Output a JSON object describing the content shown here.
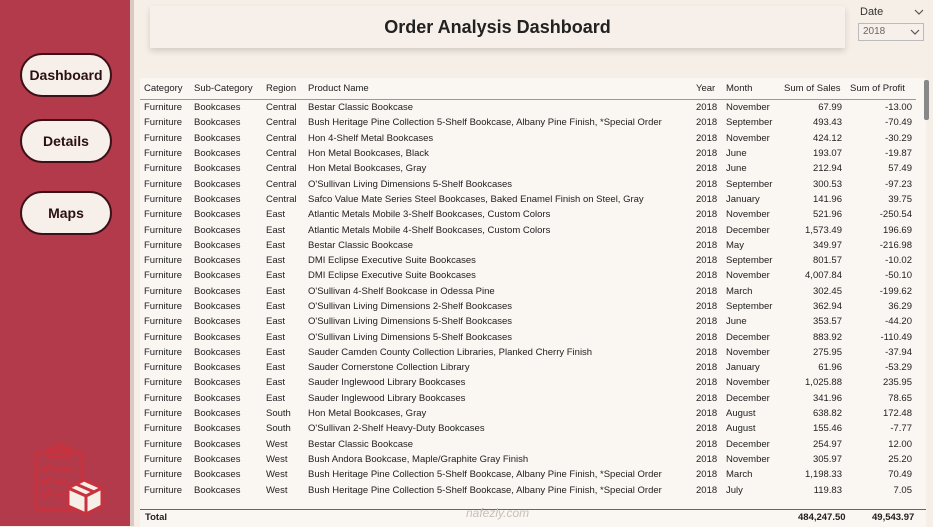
{
  "nav": {
    "dashboard": "Dashboard",
    "details": "Details",
    "maps": "Maps"
  },
  "title": "Order Analysis Dashboard",
  "date_filter": {
    "label": "Date",
    "selected": "2018"
  },
  "table": {
    "headers": [
      "Category",
      "Sub-Category",
      "Region",
      "Product Name",
      "Year",
      "Month",
      "Sum of Sales",
      "Sum of Profit"
    ],
    "rows": [
      [
        "Furniture",
        "Bookcases",
        "Central",
        "Bestar Classic Bookcase",
        "2018",
        "November",
        "67.99",
        "-13.00"
      ],
      [
        "Furniture",
        "Bookcases",
        "Central",
        "Bush Heritage Pine Collection 5-Shelf Bookcase, Albany Pine Finish, *Special Order",
        "2018",
        "September",
        "493.43",
        "-70.49"
      ],
      [
        "Furniture",
        "Bookcases",
        "Central",
        "Hon 4-Shelf Metal Bookcases",
        "2018",
        "November",
        "424.12",
        "-30.29"
      ],
      [
        "Furniture",
        "Bookcases",
        "Central",
        "Hon Metal Bookcases, Black",
        "2018",
        "June",
        "193.07",
        "-19.87"
      ],
      [
        "Furniture",
        "Bookcases",
        "Central",
        "Hon Metal Bookcases, Gray",
        "2018",
        "June",
        "212.94",
        "57.49"
      ],
      [
        "Furniture",
        "Bookcases",
        "Central",
        "O'Sullivan Living Dimensions 5-Shelf Bookcases",
        "2018",
        "September",
        "300.53",
        "-97.23"
      ],
      [
        "Furniture",
        "Bookcases",
        "Central",
        "Safco Value Mate Series Steel Bookcases, Baked Enamel Finish on Steel, Gray",
        "2018",
        "January",
        "141.96",
        "39.75"
      ],
      [
        "Furniture",
        "Bookcases",
        "East",
        "Atlantic Metals Mobile 3-Shelf Bookcases, Custom Colors",
        "2018",
        "November",
        "521.96",
        "-250.54"
      ],
      [
        "Furniture",
        "Bookcases",
        "East",
        "Atlantic Metals Mobile 4-Shelf Bookcases, Custom Colors",
        "2018",
        "December",
        "1,573.49",
        "196.69"
      ],
      [
        "Furniture",
        "Bookcases",
        "East",
        "Bestar Classic Bookcase",
        "2018",
        "May",
        "349.97",
        "-216.98"
      ],
      [
        "Furniture",
        "Bookcases",
        "East",
        "DMI Eclipse Executive Suite Bookcases",
        "2018",
        "September",
        "801.57",
        "-10.02"
      ],
      [
        "Furniture",
        "Bookcases",
        "East",
        "DMI Eclipse Executive Suite Bookcases",
        "2018",
        "November",
        "4,007.84",
        "-50.10"
      ],
      [
        "Furniture",
        "Bookcases",
        "East",
        "O'Sullivan 4-Shelf Bookcase in Odessa Pine",
        "2018",
        "March",
        "302.45",
        "-199.62"
      ],
      [
        "Furniture",
        "Bookcases",
        "East",
        "O'Sullivan Living Dimensions 2-Shelf Bookcases",
        "2018",
        "September",
        "362.94",
        "36.29"
      ],
      [
        "Furniture",
        "Bookcases",
        "East",
        "O'Sullivan Living Dimensions 5-Shelf Bookcases",
        "2018",
        "June",
        "353.57",
        "-44.20"
      ],
      [
        "Furniture",
        "Bookcases",
        "East",
        "O'Sullivan Living Dimensions 5-Shelf Bookcases",
        "2018",
        "December",
        "883.92",
        "-110.49"
      ],
      [
        "Furniture",
        "Bookcases",
        "East",
        "Sauder Camden County Collection Libraries, Planked Cherry Finish",
        "2018",
        "November",
        "275.95",
        "-37.94"
      ],
      [
        "Furniture",
        "Bookcases",
        "East",
        "Sauder Cornerstone Collection Library",
        "2018",
        "January",
        "61.96",
        "-53.29"
      ],
      [
        "Furniture",
        "Bookcases",
        "East",
        "Sauder Inglewood Library Bookcases",
        "2018",
        "November",
        "1,025.88",
        "235.95"
      ],
      [
        "Furniture",
        "Bookcases",
        "East",
        "Sauder Inglewood Library Bookcases",
        "2018",
        "December",
        "341.96",
        "78.65"
      ],
      [
        "Furniture",
        "Bookcases",
        "South",
        "Hon Metal Bookcases, Gray",
        "2018",
        "August",
        "638.82",
        "172.48"
      ],
      [
        "Furniture",
        "Bookcases",
        "South",
        "O'Sullivan 2-Shelf Heavy-Duty Bookcases",
        "2018",
        "August",
        "155.46",
        "-7.77"
      ],
      [
        "Furniture",
        "Bookcases",
        "West",
        "Bestar Classic Bookcase",
        "2018",
        "December",
        "254.97",
        "12.00"
      ],
      [
        "Furniture",
        "Bookcases",
        "West",
        "Bush Andora Bookcase, Maple/Graphite Gray Finish",
        "2018",
        "November",
        "305.97",
        "25.20"
      ],
      [
        "Furniture",
        "Bookcases",
        "West",
        "Bush Heritage Pine Collection 5-Shelf Bookcase, Albany Pine Finish, *Special Order",
        "2018",
        "March",
        "1,198.33",
        "70.49"
      ],
      [
        "Furniture",
        "Bookcases",
        "West",
        "Bush Heritage Pine Collection 5-Shelf Bookcase, Albany Pine Finish, *Special Order",
        "2018",
        "July",
        "119.83",
        "7.05"
      ]
    ],
    "total": {
      "label": "Total",
      "sales": "484,247.50",
      "profit": "49,543.97"
    }
  },
  "watermark": "nafezly.com",
  "colors": {
    "sidebar": "#b23a4a",
    "background": "#f6efe7",
    "icon": "#c8323f"
  },
  "icons": {
    "clipboard": "clipboard-checklist-icon",
    "box": "package-box-icon"
  }
}
